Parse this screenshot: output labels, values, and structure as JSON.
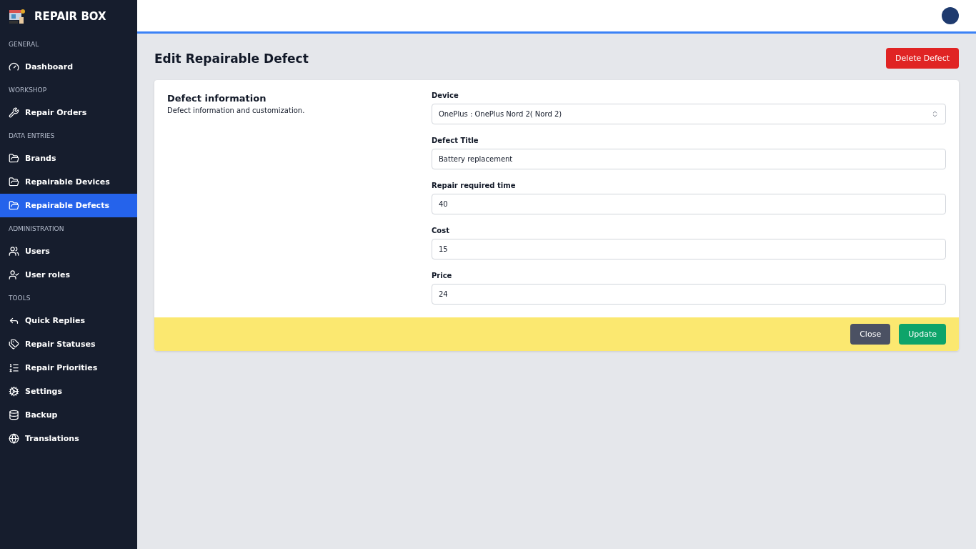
{
  "brand": {
    "name": "REPAIR BOX"
  },
  "sidebar": {
    "sections": [
      {
        "title": "GENERAL",
        "items": [
          {
            "label": "Dashboard",
            "selected": false
          }
        ]
      },
      {
        "title": "WORKSHOP",
        "items": [
          {
            "label": "Repair Orders",
            "selected": false
          }
        ]
      },
      {
        "title": "DATA ENTRIES",
        "items": [
          {
            "label": "Brands",
            "selected": false
          },
          {
            "label": "Repairable Devices",
            "selected": false
          },
          {
            "label": "Repairable Defects",
            "selected": true
          }
        ]
      },
      {
        "title": "ADMINISTRATION",
        "items": [
          {
            "label": "Users",
            "selected": false
          },
          {
            "label": "User roles",
            "selected": false
          }
        ]
      },
      {
        "title": "TOOLS",
        "items": [
          {
            "label": "Quick Replies",
            "selected": false
          },
          {
            "label": "Repair Statuses",
            "selected": false
          },
          {
            "label": "Repair Priorities",
            "selected": false
          },
          {
            "label": "Settings",
            "selected": false
          },
          {
            "label": "Backup",
            "selected": false
          },
          {
            "label": "Translations",
            "selected": false
          }
        ]
      }
    ]
  },
  "page": {
    "title": "Edit Repairable Defect",
    "delete_button": "Delete Defect"
  },
  "form": {
    "title": "Defect information",
    "description": "Defect information and customization.",
    "fields": [
      {
        "label": "Device",
        "kind": "select",
        "value": "OnePlus : OnePlus Nord 2( Nord 2)"
      },
      {
        "label": "Defect Title",
        "kind": "text",
        "value": "Battery replacement"
      },
      {
        "label": "Repair required time",
        "kind": "text",
        "value": "40"
      },
      {
        "label": "Cost",
        "kind": "text",
        "value": "15"
      },
      {
        "label": "Price",
        "kind": "text",
        "value": "24"
      }
    ],
    "buttons": [
      {
        "label": "Close",
        "kind": "secondary"
      },
      {
        "label": "Update",
        "kind": "primary"
      }
    ]
  }
}
